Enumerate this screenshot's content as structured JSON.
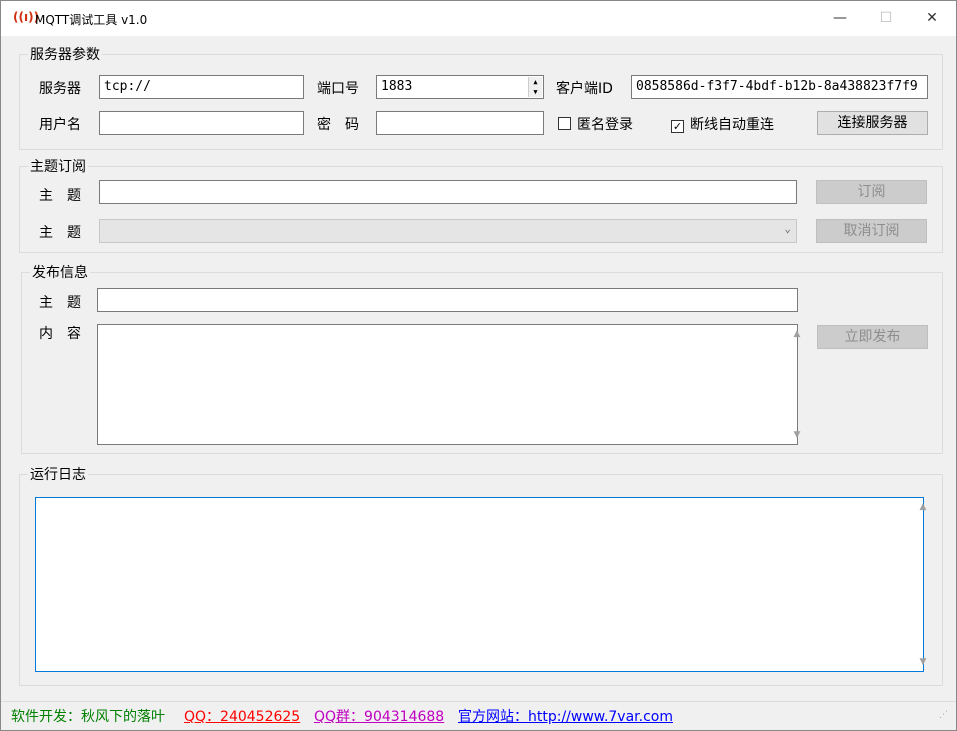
{
  "window": {
    "title": "MQTT调试工具 v1.0",
    "minimize": "—",
    "maximize": "☐",
    "close": "✕"
  },
  "server": {
    "legend": "服务器参数",
    "server_label": "服务器",
    "server_value": "tcp://",
    "port_label": "端口号",
    "port_value": "1883",
    "client_id_label": "客户端ID",
    "client_id_value": "0858586d-f3f7-4bdf-b12b-8a438823f7f9",
    "username_label": "用户名",
    "username_value": "",
    "password_label": "密　码",
    "password_value": "",
    "anonymous_label": "匿名登录",
    "anonymous_checked": false,
    "reconnect_label": "断线自动重连",
    "reconnect_checked": true,
    "connect_button": "连接服务器"
  },
  "subscribe": {
    "legend": "主题订阅",
    "topic_label": "主　题",
    "topic_value": "",
    "subscribe_button": "订阅",
    "topic2_label": "主　题",
    "unsubscribe_button": "取消订阅"
  },
  "publish": {
    "legend": "发布信息",
    "topic_label": "主　题",
    "topic_value": "",
    "content_label": "内　容",
    "content_value": "",
    "publish_button": "立即发布"
  },
  "log": {
    "legend": "运行日志",
    "content": ""
  },
  "status": {
    "developer": "软件开发：秋风下的落叶",
    "qq": "QQ：240452625",
    "qq_group": "QQ群：904314688",
    "website": "官方网站：http://www.7var.com",
    "colors": {
      "developer": "#008000",
      "qq": "#ff0000",
      "qq_group": "#c000c0",
      "website": "#0000ff"
    }
  }
}
